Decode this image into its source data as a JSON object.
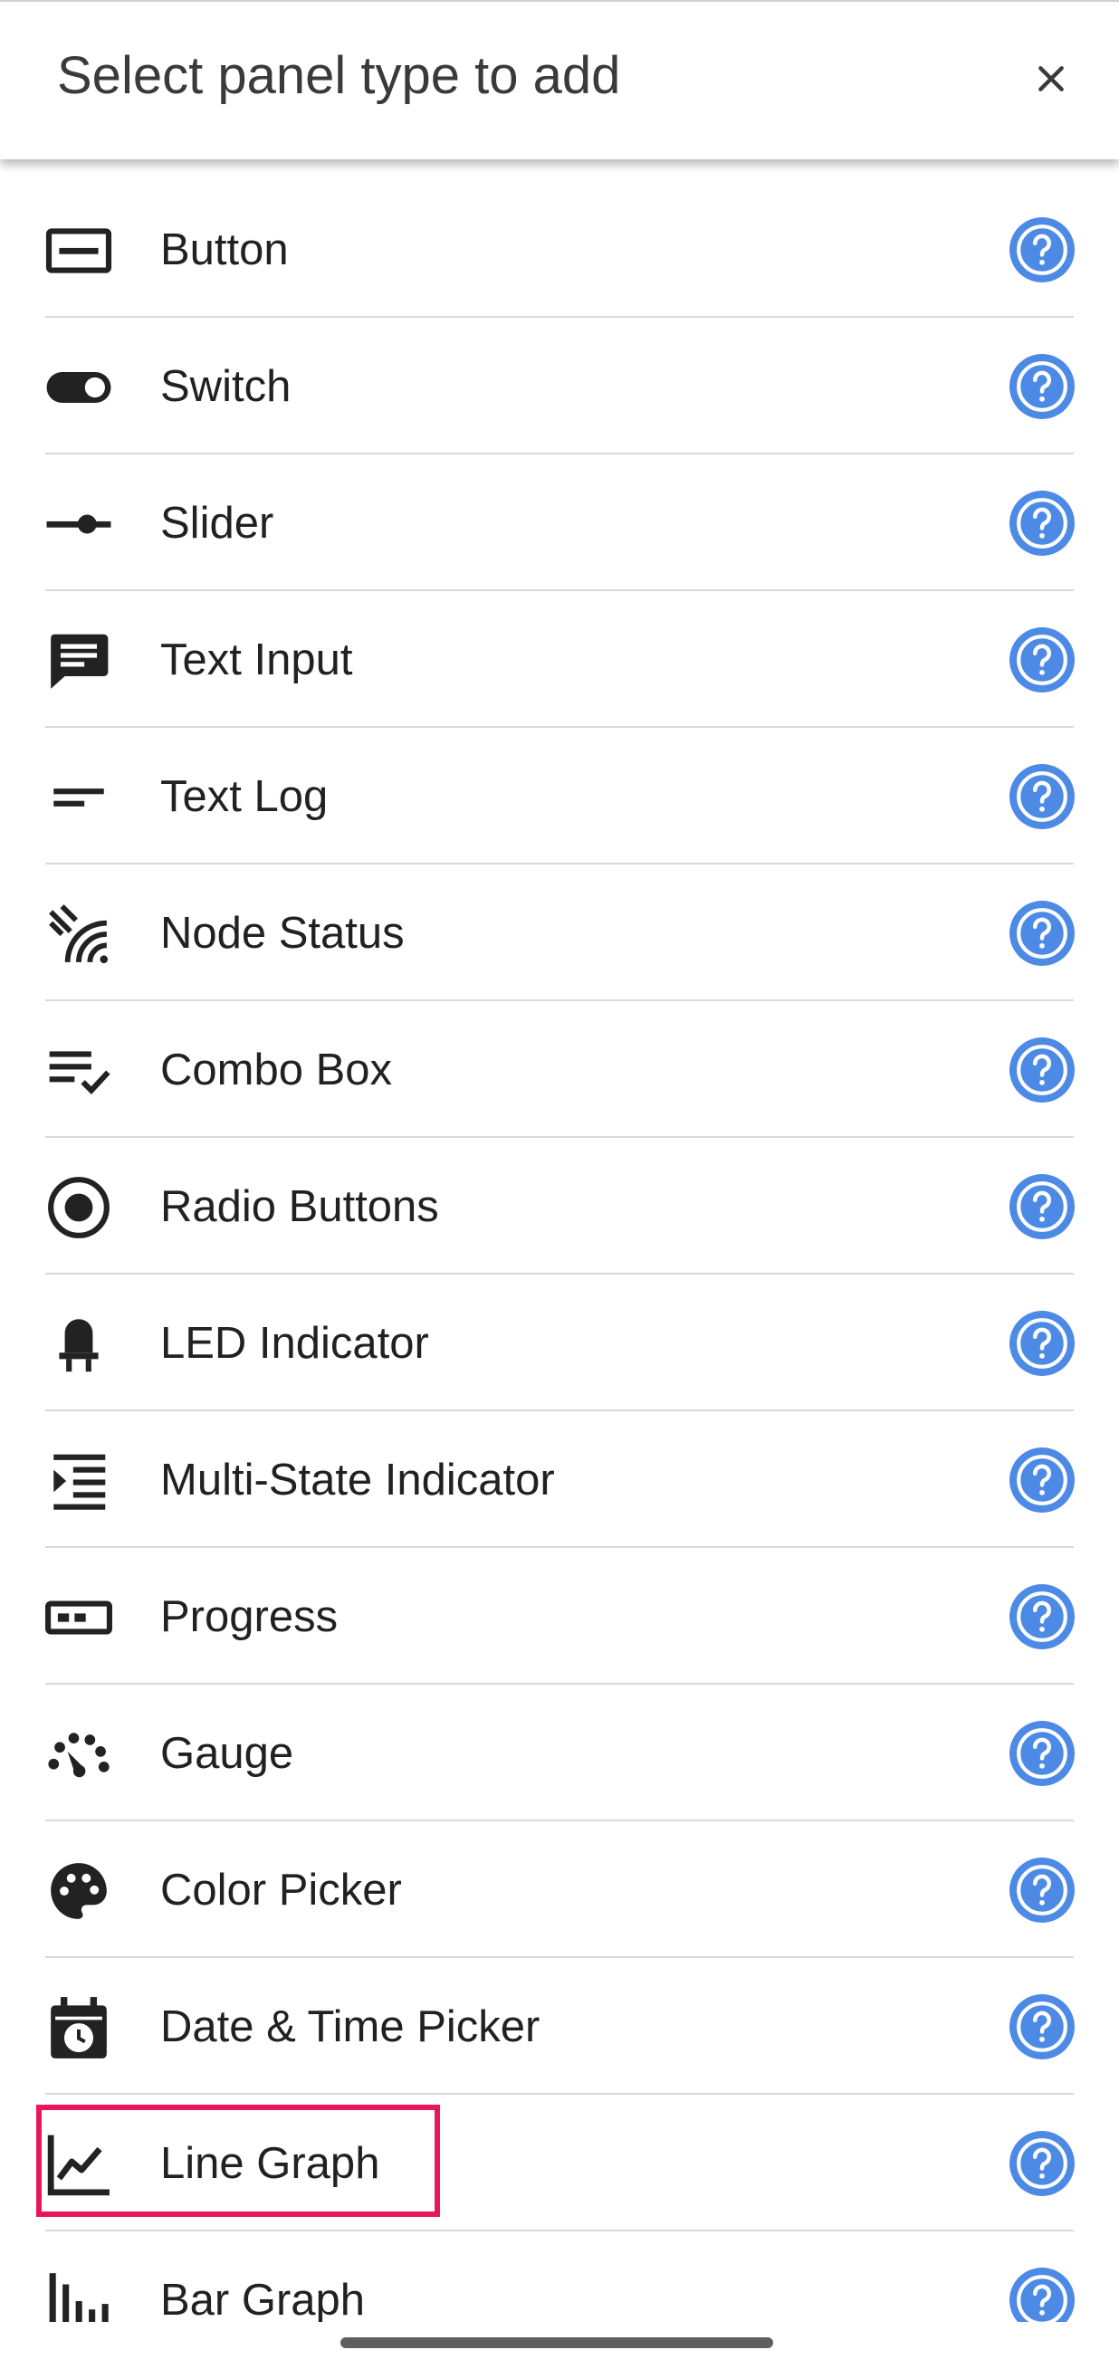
{
  "header": {
    "title": "Select panel type to add",
    "close_icon": "close-icon"
  },
  "help_icon": "help-circle-icon",
  "accent_color": "#4d8ae6",
  "highlight_color": "#e8175d",
  "items": [
    {
      "label": "Button",
      "icon": "button-icon"
    },
    {
      "label": "Switch",
      "icon": "toggle-switch-icon"
    },
    {
      "label": "Slider",
      "icon": "slider-icon"
    },
    {
      "label": "Text Input",
      "icon": "message-text-icon"
    },
    {
      "label": "Text Log",
      "icon": "text-short-icon"
    },
    {
      "label": "Node Status",
      "icon": "signal-status-icon"
    },
    {
      "label": "Combo Box",
      "icon": "list-check-icon"
    },
    {
      "label": "Radio Buttons",
      "icon": "radio-button-icon"
    },
    {
      "label": "LED Indicator",
      "icon": "led-icon"
    },
    {
      "label": "Multi-State Indicator",
      "icon": "indent-list-icon"
    },
    {
      "label": "Progress",
      "icon": "progress-bar-icon"
    },
    {
      "label": "Gauge",
      "icon": "gauge-icon"
    },
    {
      "label": "Color Picker",
      "icon": "palette-icon"
    },
    {
      "label": "Date & Time Picker",
      "icon": "calendar-clock-icon"
    },
    {
      "label": "Line Graph",
      "icon": "line-chart-icon"
    },
    {
      "label": "Bar Graph",
      "icon": "bar-chart-icon"
    }
  ]
}
